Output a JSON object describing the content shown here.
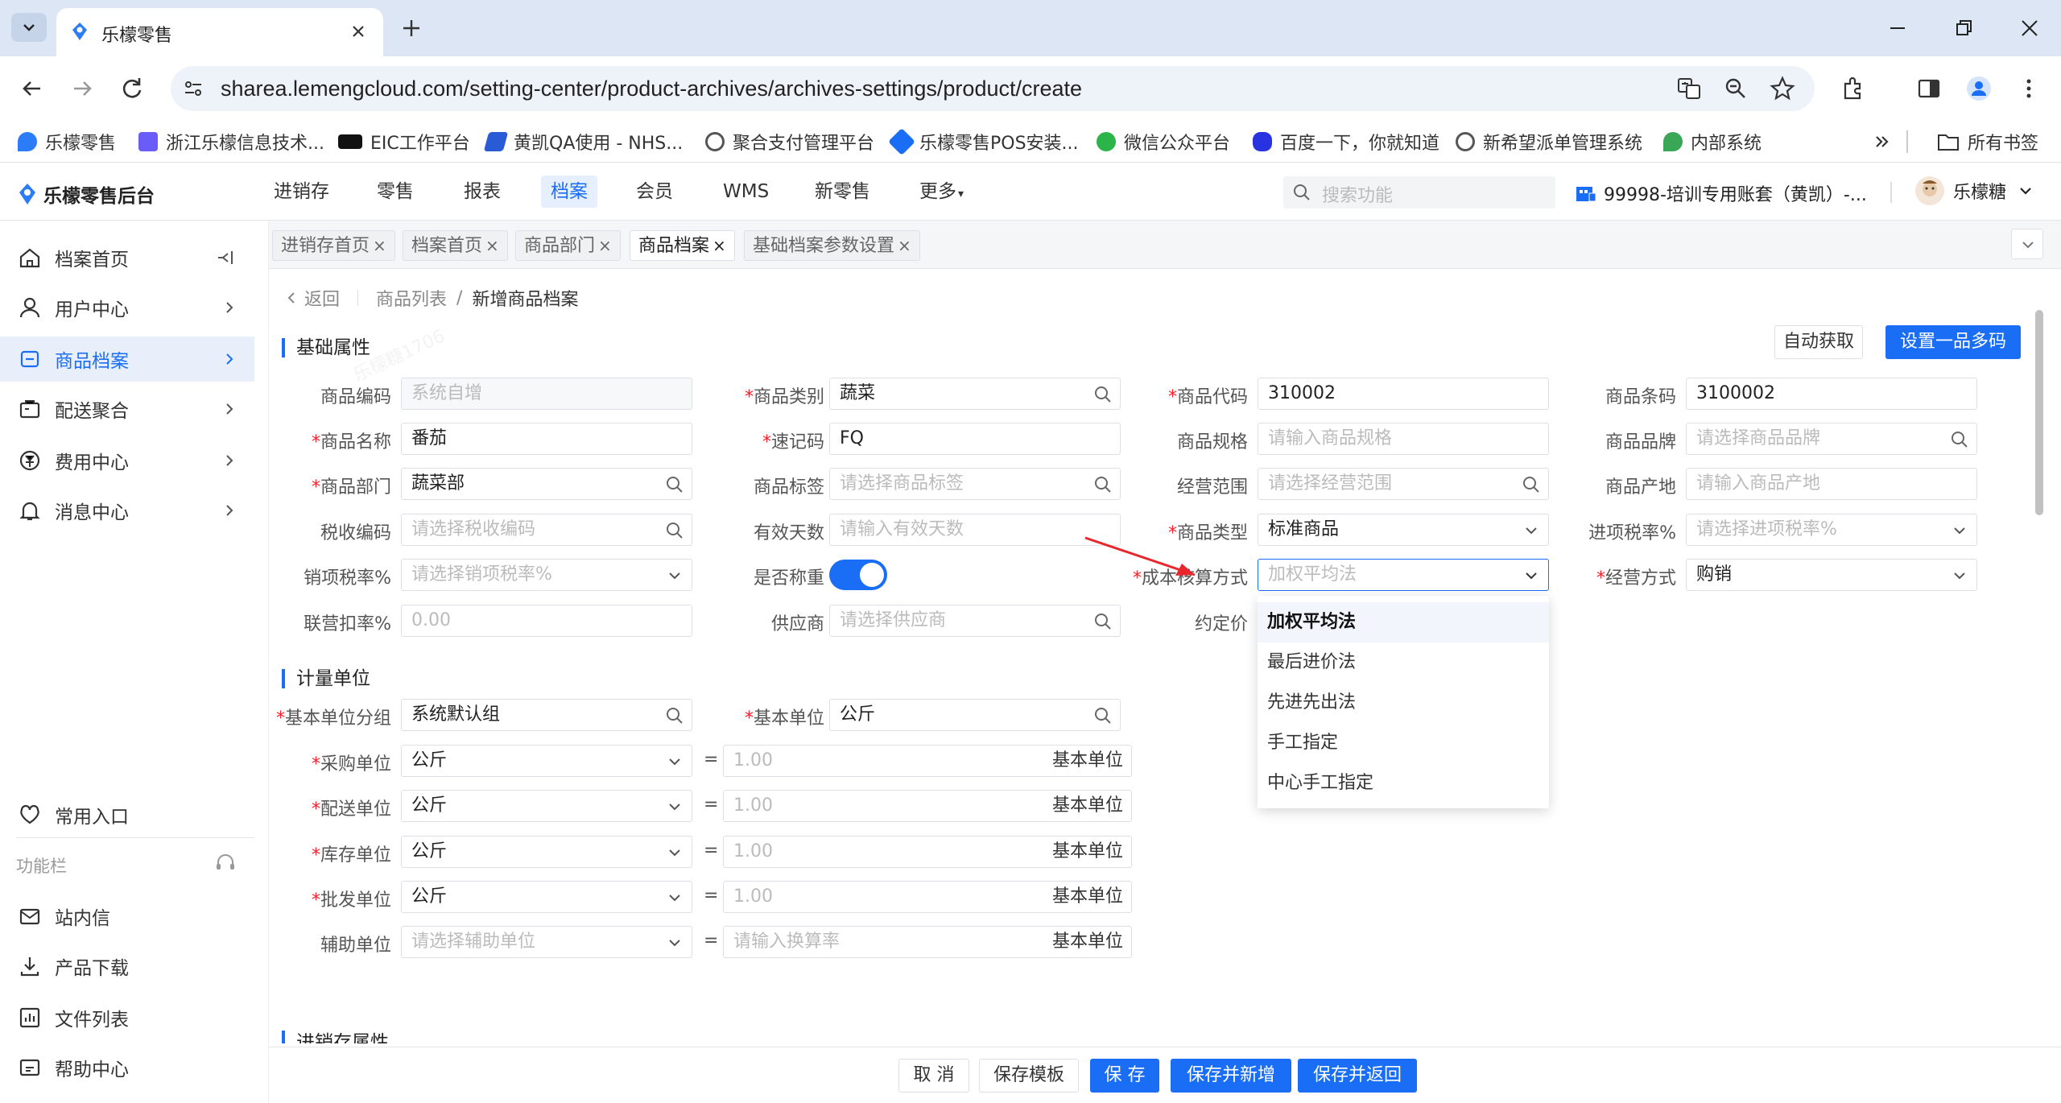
{
  "browser": {
    "tab_title": "乐檬零售",
    "url": "sharea.lemengcloud.com/setting-center/product-archives/archives-settings/product/create",
    "bookmarks": [
      "乐檬零售",
      "浙江乐檬信息技术...",
      "EIC工作平台",
      "黄凯QA使用 - NHS...",
      "聚合支付管理平台",
      "乐檬零售POS安装...",
      "微信公众平台",
      "百度一下，你就知道",
      "新希望派单管理系统",
      "内部系统"
    ],
    "all_bookmarks": "所有书签"
  },
  "app": {
    "logo": "乐檬零售后台",
    "topnav": [
      "进销存",
      "零售",
      "报表",
      "档案",
      "会员",
      "WMS",
      "新零售",
      "更多"
    ],
    "active_nav": "档案",
    "search_placeholder": "搜索功能",
    "account": "99998-培训专用账套（黄凯）-...",
    "user": "乐檬糖"
  },
  "sidebar": {
    "items": [
      {
        "label": "档案首页",
        "icon": "home-icon"
      },
      {
        "label": "用户中心",
        "icon": "user-icon"
      },
      {
        "label": "商品档案",
        "icon": "product-icon"
      },
      {
        "label": "配送聚合",
        "icon": "delivery-icon"
      },
      {
        "label": "费用中心",
        "icon": "fee-icon"
      },
      {
        "label": "消息中心",
        "icon": "bell-icon"
      }
    ],
    "common_entry": "常用入口",
    "func_bar": "功能栏",
    "bottom_items": [
      "站内信",
      "产品下载",
      "文件列表",
      "帮助中心"
    ]
  },
  "tabs": [
    "进销存首页",
    "档案首页",
    "商品部门",
    "商品档案",
    "基础档案参数设置"
  ],
  "active_tab": "商品档案",
  "breadcrumb": {
    "back": "返回",
    "parent": "商品列表",
    "current": "新增商品档案"
  },
  "buttons": {
    "auto_fetch": "自动获取",
    "multi_code": "设置一品多码"
  },
  "sections": {
    "basic": "基础属性",
    "unit": "计量单位",
    "inventory": "进销存属性"
  },
  "form": {
    "code": {
      "label": "商品编码",
      "placeholder": "系统自增"
    },
    "category": {
      "label": "商品类别",
      "value": "蔬菜"
    },
    "item_code": {
      "label": "商品代码",
      "value": "310002"
    },
    "barcode": {
      "label": "商品条码",
      "value": "3100002"
    },
    "name": {
      "label": "商品名称",
      "value": "番茄"
    },
    "quick_code": {
      "label": "速记码",
      "value": "FQ"
    },
    "spec": {
      "label": "商品规格",
      "placeholder": "请输入商品规格"
    },
    "brand": {
      "label": "商品品牌",
      "placeholder": "请选择商品品牌"
    },
    "dept": {
      "label": "商品部门",
      "value": "蔬菜部"
    },
    "tag": {
      "label": "商品标签",
      "placeholder": "请选择商品标签"
    },
    "scope": {
      "label": "经营范围",
      "placeholder": "请选择经营范围"
    },
    "origin": {
      "label": "商品产地",
      "placeholder": "请输入商品产地"
    },
    "tax_code": {
      "label": "税收编码",
      "placeholder": "请选择税收编码"
    },
    "valid_days": {
      "label": "有效天数",
      "placeholder": "请输入有效天数"
    },
    "type": {
      "label": "商品类型",
      "value": "标准商品"
    },
    "input_tax": {
      "label": "进项税率%",
      "placeholder": "请选择进项税率%"
    },
    "output_tax": {
      "label": "销项税率%",
      "placeholder": "请选择销项税率%"
    },
    "weighing": {
      "label": "是否称重",
      "on": true
    },
    "cost_method": {
      "label": "成本核算方式",
      "placeholder": "加权平均法"
    },
    "biz_mode": {
      "label": "经营方式",
      "value": "购销"
    },
    "joint_rate": {
      "label": "联营扣率%",
      "value": "0.00"
    },
    "supplier": {
      "label": "供应商",
      "placeholder": "请选择供应商"
    },
    "fixed_price": {
      "label": "约定价"
    }
  },
  "units": {
    "group": {
      "label": "基本单位分组",
      "value": "系统默认组"
    },
    "base": {
      "label": "基本单位",
      "value": "公斤"
    },
    "rows": [
      {
        "label": "采购单位",
        "value": "公斤",
        "ratio": "1.00",
        "placeholder": false
      },
      {
        "label": "配送单位",
        "value": "公斤",
        "ratio": "1.00",
        "placeholder": false
      },
      {
        "label": "库存单位",
        "value": "公斤",
        "ratio": "1.00",
        "placeholder": false
      },
      {
        "label": "批发单位",
        "value": "公斤",
        "ratio": "1.00",
        "placeholder": false
      },
      {
        "label": "辅助单位",
        "value": "请选择辅助单位",
        "ratio": "请输入换算率",
        "placeholder": true
      }
    ],
    "eq": "=",
    "base_unit_text": "基本单位"
  },
  "dropdown": {
    "options": [
      "加权平均法",
      "最后进价法",
      "先进先出法",
      "手工指定",
      "中心手工指定"
    ],
    "selected": "加权平均法"
  },
  "footer": {
    "cancel": "取 消",
    "save_template": "保存模板",
    "save": "保 存",
    "save_new": "保存并新增",
    "save_return": "保存并返回"
  },
  "watermark": "乐檬糖1706"
}
